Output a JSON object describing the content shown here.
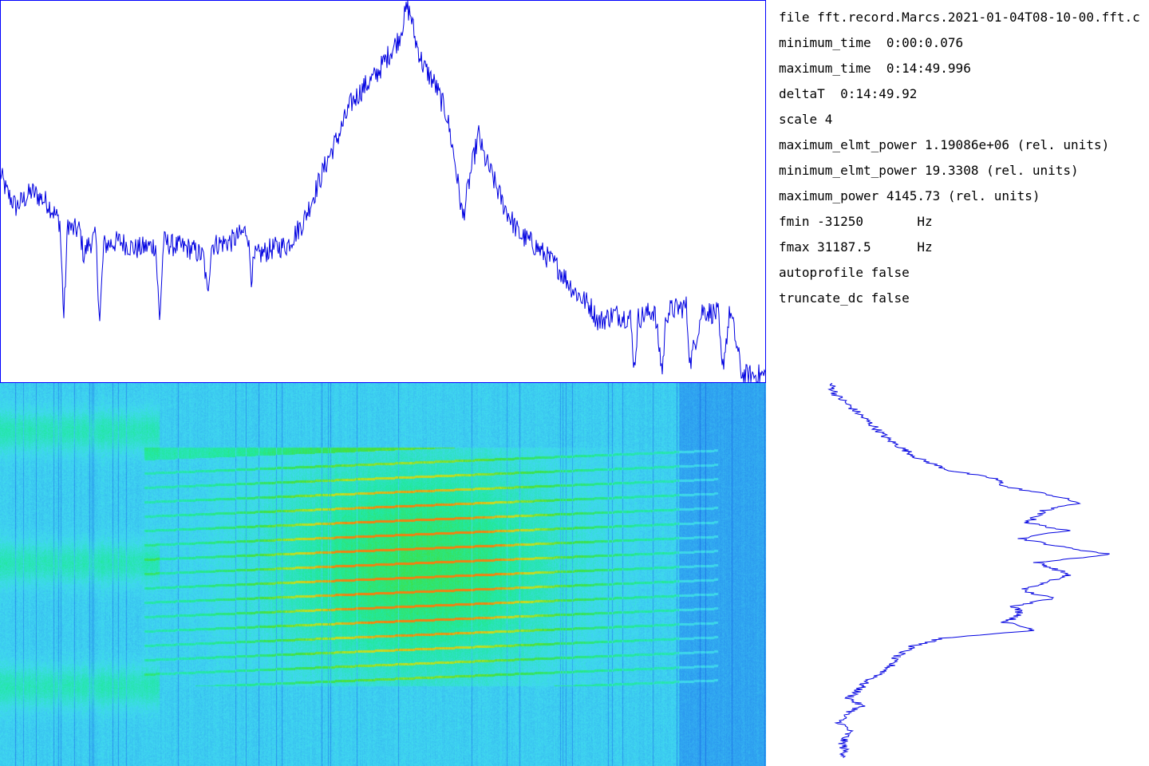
{
  "info": {
    "lines": [
      "file fft.record.Marcs.2021-01-04T08-10-00.fft.c",
      "minimum_time  0:00:0.076",
      "maximum_time  0:14:49.996",
      "deltaT  0:14:49.92",
      "scale 4",
      "maximum_elmt_power 1.19086e+06 (rel. units)",
      "minimum_elmt_power 19.3308 (rel. units)",
      "maximum_power 4145.73 (rel. units)",
      "fmin -31250       Hz",
      "fmax 31187.5      Hz",
      "autoprofile false",
      "truncate_dc false"
    ]
  },
  "colors": {
    "trace": "#0000e0",
    "frame": "#0000ff",
    "background": "#ffffff"
  },
  "chart_data": [
    {
      "type": "line",
      "title": "",
      "xlabel": "",
      "ylabel": "",
      "x": [
        0,
        8,
        20,
        40,
        60,
        75,
        80,
        85,
        90,
        100,
        105,
        110,
        120,
        125,
        130,
        150,
        170,
        195,
        200,
        205,
        215,
        240,
        255,
        260,
        265,
        290,
        310,
        315,
        320,
        340,
        360,
        380,
        395,
        410,
        425,
        440,
        455,
        470,
        485,
        500,
        510,
        515,
        520,
        530,
        545,
        560,
        570,
        580,
        590,
        600,
        605,
        615,
        630,
        650,
        670,
        690,
        700,
        720,
        740,
        750,
        770,
        790,
        795,
        800,
        810,
        820,
        830,
        835,
        840,
        860,
        865,
        880,
        900,
        905,
        915,
        930,
        960
      ],
      "values": [
        0.55,
        0.5,
        0.46,
        0.5,
        0.47,
        0.42,
        0.17,
        0.42,
        0.4,
        0.4,
        0.33,
        0.36,
        0.38,
        0.16,
        0.36,
        0.37,
        0.35,
        0.36,
        0.16,
        0.37,
        0.36,
        0.35,
        0.33,
        0.23,
        0.36,
        0.37,
        0.4,
        0.28,
        0.33,
        0.35,
        0.36,
        0.42,
        0.5,
        0.58,
        0.65,
        0.73,
        0.77,
        0.8,
        0.85,
        0.9,
        0.98,
        0.96,
        0.9,
        0.83,
        0.78,
        0.7,
        0.58,
        0.43,
        0.55,
        0.65,
        0.6,
        0.55,
        0.47,
        0.39,
        0.36,
        0.32,
        0.3,
        0.24,
        0.2,
        0.16,
        0.18,
        0.17,
        0.04,
        0.17,
        0.18,
        0.19,
        0.03,
        0.18,
        0.19,
        0.2,
        0.05,
        0.19,
        0.18,
        0.03,
        0.19,
        0.02,
        0.02
      ],
      "xlim": [
        0,
        960
      ],
      "ylim": [
        0,
        1
      ]
    },
    {
      "type": "line",
      "title": "",
      "xlabel": "",
      "ylabel": "",
      "y": [
        0,
        15,
        35,
        55,
        70,
        80,
        95,
        110,
        120,
        130,
        140,
        150,
        160,
        175,
        185,
        195,
        205,
        215,
        225,
        240,
        260,
        270,
        280,
        290,
        300,
        310,
        320,
        330,
        345,
        355,
        365,
        375,
        385,
        395,
        405,
        415,
        425,
        435,
        450,
        470
      ],
      "values": [
        0.0,
        0.02,
        0.08,
        0.14,
        0.18,
        0.22,
        0.28,
        0.38,
        0.52,
        0.55,
        0.69,
        0.78,
        0.67,
        0.62,
        0.74,
        0.6,
        0.72,
        0.88,
        0.65,
        0.75,
        0.6,
        0.7,
        0.58,
        0.6,
        0.55,
        0.65,
        0.35,
        0.26,
        0.2,
        0.19,
        0.16,
        0.11,
        0.09,
        0.06,
        0.1,
        0.05,
        0.03,
        0.06,
        0.04,
        0.05
      ],
      "xlim": [
        0,
        1
      ],
      "ylim": [
        0,
        480
      ]
    }
  ],
  "spectrogram": {
    "type": "heatmap",
    "colormap": [
      "#1e74e8",
      "#2ea0f0",
      "#40d8f0",
      "#20e8a0",
      "#40e040",
      "#c8e020",
      "#f08010"
    ],
    "band_spacing": 18,
    "bands_top": 560,
    "bands_bottom": 860,
    "peak_x": 520
  }
}
